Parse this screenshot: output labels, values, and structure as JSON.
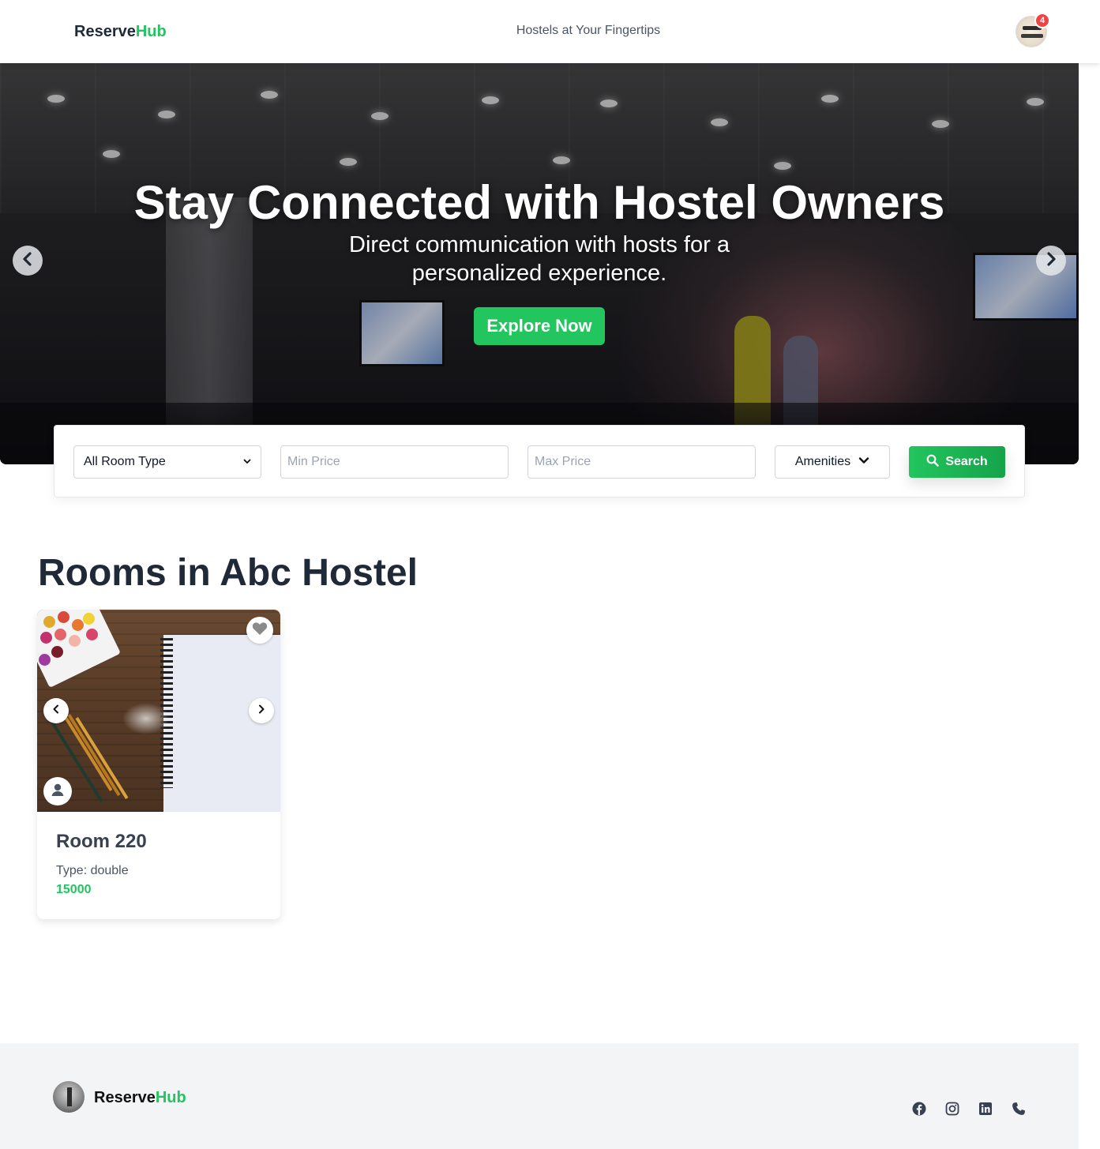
{
  "header": {
    "brand_main": "Reserve",
    "brand_accent": "Hub",
    "tagline": "Hostels at Your Fingertips",
    "notification_count": "4",
    "avatar_icon": "user-avatar"
  },
  "hero": {
    "title": "Stay Connected with Hostel Owners",
    "subtitle": "Direct communication with hosts for a personalized experience.",
    "cta_label": "Explore Now",
    "prev_icon": "chevron-left-icon",
    "next_icon": "chevron-right-icon"
  },
  "search": {
    "room_type_selected": "All Room Type",
    "min_price_placeholder": "Min Price",
    "max_price_placeholder": "Max Price",
    "amenities_label": "Amenities",
    "search_label": "Search"
  },
  "rooms_section": {
    "title": "Rooms in Abc Hostel",
    "rooms": [
      {
        "name": "Room 220",
        "type": "Type: double",
        "price": "15000"
      }
    ]
  },
  "footer": {
    "brand_main": "Reserve",
    "brand_accent": "Hub",
    "social_icons": [
      "facebook-icon",
      "instagram-icon",
      "linkedin-icon",
      "phone-icon"
    ]
  },
  "colors": {
    "accent": "#22c55e",
    "badge": "#ef4444",
    "footer_bg": "#f3f4f6",
    "text_dark": "#1f2937"
  }
}
